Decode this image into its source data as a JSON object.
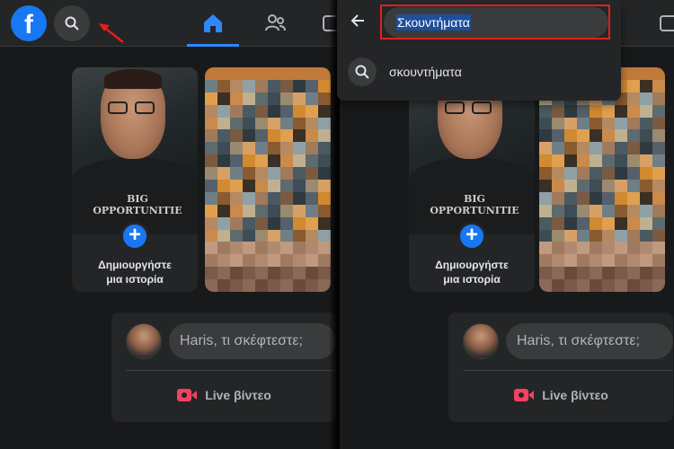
{
  "left": {
    "logo_letter": "f",
    "story": {
      "create_label_line1": "Δημιουργήστε",
      "create_label_line2": "μια ιστορία",
      "plus": "+",
      "hoodie_line1": "BIG",
      "hoodie_line2": "OPPORTUNITIE"
    },
    "composer": {
      "placeholder": "Haris, τι σκέφτεστε;",
      "live_label": "Live βίντεο"
    }
  },
  "right": {
    "search": {
      "query": "Σκουντήματα",
      "suggestion": "σκουντήματα"
    },
    "story": {
      "create_label_line1": "Δημιουργήστε",
      "create_label_line2": "μια ιστορία",
      "plus": "+",
      "hoodie_line1": "BIG",
      "hoodie_line2": "OPPORTUNITIE"
    },
    "composer": {
      "placeholder": "Haris, τι σκέφτεστε;",
      "live_label": "Live βίντεο"
    }
  },
  "colors": {
    "accent": "#1877f2",
    "highlight": "#e02020",
    "live": "#f3425f"
  }
}
